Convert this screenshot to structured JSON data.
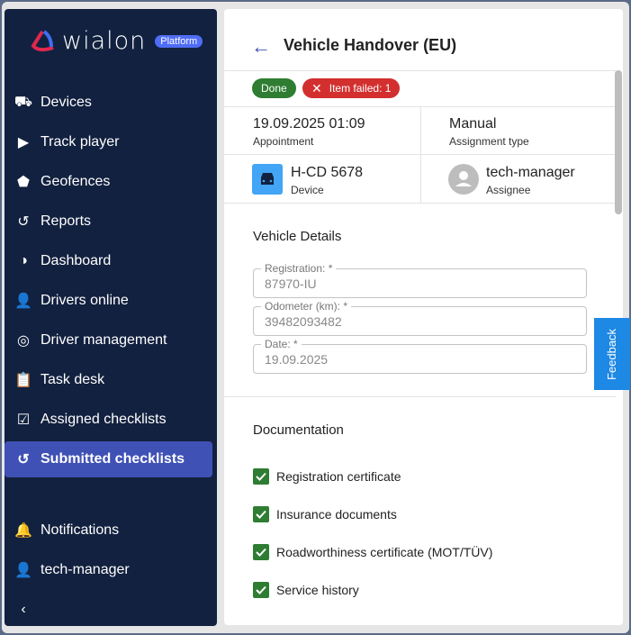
{
  "logo": {
    "text": "wialon",
    "badge": "Platform"
  },
  "sidebar": {
    "items": [
      {
        "label": "Devices",
        "icon": "devices-icon"
      },
      {
        "label": "Track player",
        "icon": "play-icon"
      },
      {
        "label": "Geofences",
        "icon": "pentagon-icon"
      },
      {
        "label": "Reports",
        "icon": "history-icon"
      },
      {
        "label": "Dashboard",
        "icon": "pie-icon"
      },
      {
        "label": "Drivers online",
        "icon": "driver-icon"
      },
      {
        "label": "Driver management",
        "icon": "steering-icon"
      },
      {
        "label": "Task desk",
        "icon": "clipboard-icon"
      },
      {
        "label": "Assigned checklists",
        "icon": "checklist-icon"
      },
      {
        "label": "Submitted checklists",
        "icon": "history-icon"
      },
      {
        "label": "Notifications",
        "icon": "bell-icon"
      },
      {
        "label": "tech-manager",
        "icon": "user-icon"
      }
    ]
  },
  "card": {
    "title": "Vehicle Handover (EU)",
    "badges": {
      "done": "Done",
      "failed": "Item failed: 1"
    },
    "appointment": {
      "value": "19.09.2025 01:09",
      "label": "Appointment"
    },
    "assignment": {
      "value": "Manual",
      "label": "Assignment type"
    },
    "device": {
      "value": "H-CD 5678",
      "label": "Device"
    },
    "assignee": {
      "value": "tech-manager",
      "label": "Assignee"
    },
    "vehicle_details": "Vehicle Details",
    "fields": [
      {
        "label": "Registration: *",
        "value": "87970-IU"
      },
      {
        "label": "Odometer (km): *",
        "value": "39482093482"
      },
      {
        "label": "Date: *",
        "value": "19.09.2025"
      }
    ],
    "documentation": "Documentation",
    "checks": [
      "Registration certificate",
      "Insurance documents",
      "Roadworthiness certificate (MOT/TÜV)",
      "Service history"
    ]
  },
  "feedback": "Feedback",
  "colors": {
    "sidebar": "#12213f",
    "active": "#3f51b5",
    "done": "#2e7d32",
    "failed": "#d32f2f"
  }
}
